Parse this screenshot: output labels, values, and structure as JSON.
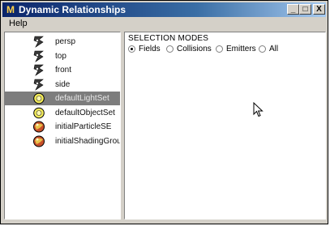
{
  "window": {
    "title": "Dynamic Relationships",
    "icon": "maya-icon",
    "buttons": {
      "minimize": "_",
      "maximize": "□",
      "close": "X"
    }
  },
  "menu": {
    "items": [
      {
        "label": "Help"
      }
    ]
  },
  "objects": [
    {
      "label": "persp",
      "icon": "camera-icon",
      "selected": false
    },
    {
      "label": "top",
      "icon": "camera-icon",
      "selected": false
    },
    {
      "label": "front",
      "icon": "camera-icon",
      "selected": false
    },
    {
      "label": "side",
      "icon": "camera-icon",
      "selected": false
    },
    {
      "label": "defaultLightSet",
      "icon": "set-icon",
      "selected": true
    },
    {
      "label": "defaultObjectSet",
      "icon": "set-icon",
      "selected": false
    },
    {
      "label": "initialParticleSE",
      "icon": "shading-group-icon",
      "selected": false
    },
    {
      "label": "initialShadingGroup",
      "icon": "shading-group-icon",
      "selected": false
    }
  ],
  "selection_modes": {
    "header": "SELECTION MODES",
    "options": [
      {
        "label": "Fields",
        "checked": true
      },
      {
        "label": "Collisions",
        "checked": false
      },
      {
        "label": "Emitters",
        "checked": false
      },
      {
        "label": "All",
        "checked": false
      }
    ]
  }
}
